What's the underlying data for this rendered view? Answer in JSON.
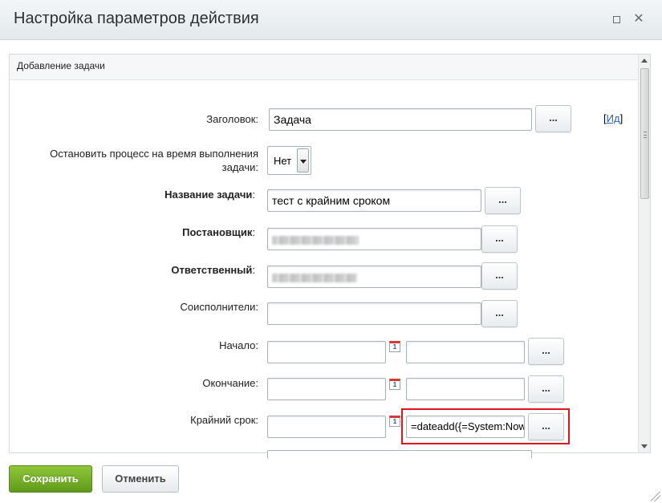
{
  "window": {
    "title": "Настройка параметров действия",
    "maximize_icon": "maximize-icon",
    "close_icon": "close-icon",
    "close_glyph": "✕"
  },
  "section": {
    "title": "Добавление задачи"
  },
  "form": {
    "title_label": "Заголовок:",
    "title_value": "Задача",
    "ident_open": "[",
    "ident_link": "Ид",
    "ident_close": "]",
    "stop_label": "Остановить процесс на время выполнения задачи:",
    "stop_value": "Нет",
    "task_name_label": "Название задачи",
    "task_name_colon": ":",
    "task_name_value": "тест с крайним сроком",
    "creator_label": "Постановщик",
    "creator_colon": ":",
    "responsible_label": "Ответственный",
    "responsible_colon": ":",
    "coexecutors_label": "Соисполнители:",
    "start_label": "Начало:",
    "end_label": "Окончание:",
    "deadline_label": "Крайний срок:",
    "deadline_formula": "=dateadd({=System:Now",
    "dots_label": "...",
    "calendar_text": "1"
  },
  "footer": {
    "save_label": "Сохранить",
    "cancel_label": "Отменить"
  },
  "colors": {
    "save_button": "#6ea62a",
    "highlight_border": "#e0141b",
    "link": "#2067b0"
  }
}
